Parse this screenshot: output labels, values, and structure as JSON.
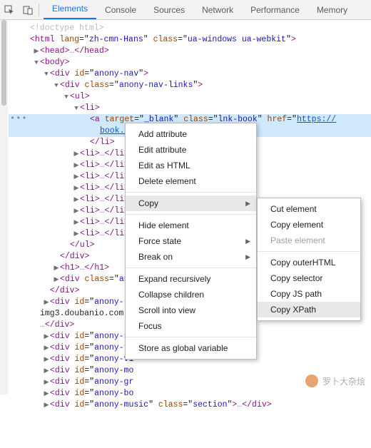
{
  "tabs": [
    "Elements",
    "Console",
    "Sources",
    "Network",
    "Performance",
    "Memory"
  ],
  "active_tab": 0,
  "dom_lines": [
    {
      "i": 1,
      "a": "none",
      "html": "<span class='doctype'>&lt;!doctype html&gt;</span>"
    },
    {
      "i": 1,
      "a": "none",
      "html": "<span class='tagb'>&lt;html</span> <span class='attrn'>lang</span>=\"<span class='attrv'>zh-cmn-Hans</span>\" <span class='attrn'>class</span>=\"<span class='attrv'>ua-windows ua-webkit</span>\"<span class='tagb'>&gt;</span>"
    },
    {
      "i": 2,
      "a": "right",
      "html": "<span class='tagb'>&lt;head&gt;</span><span class='ellips'>…</span><span class='tagb'>&lt;/head&gt;</span>"
    },
    {
      "i": 2,
      "a": "down",
      "html": "<span class='tagb'>&lt;body&gt;</span>"
    },
    {
      "i": 3,
      "a": "down",
      "html": "<span class='tagb'>&lt;div</span> <span class='attrn'>id</span>=\"<span class='attrv'>anony-nav</span>\"<span class='tagb'>&gt;</span>"
    },
    {
      "i": 4,
      "a": "down",
      "html": "<span class='tagb'>&lt;div</span> <span class='attrn'>class</span>=\"<span class='attrv'>anony-nav-links</span>\"<span class='tagb'>&gt;</span>"
    },
    {
      "i": 5,
      "a": "down",
      "html": "<span class='tagb'>&lt;ul&gt;</span>"
    },
    {
      "i": 6,
      "a": "down",
      "html": "<span class='tagb'>&lt;li&gt;</span>"
    },
    {
      "i": 7,
      "a": "none",
      "sel": true,
      "html": "<span class='tagb'>&lt;a</span> <span class='attrn'>target</span>=\"<span class='attrv'>_blank</span>\" <span class='attrn'>class</span>=\"<span class='attrv'>lnk-book</span>\" <span class='attrn'>href</span>=\"<span class='url'>https://</span>"
    },
    {
      "i": 8,
      "a": "none",
      "sel": true,
      "html": "<span class='url'>book.doub</span>"
    },
    {
      "i": 7,
      "a": "none",
      "html": "<span class='tagb'>&lt;/li&gt;</span>"
    },
    {
      "i": 6,
      "a": "right",
      "html": "<span class='tagb'>&lt;li&gt;</span><span class='ellips'>…</span><span class='tagb'>&lt;/li&gt;</span>"
    },
    {
      "i": 6,
      "a": "right",
      "html": "<span class='tagb'>&lt;li&gt;</span><span class='ellips'>…</span><span class='tagb'>&lt;/li&gt;</span>"
    },
    {
      "i": 6,
      "a": "right",
      "html": "<span class='tagb'>&lt;li&gt;</span><span class='ellips'>…</span><span class='tagb'>&lt;/li&gt;</span>"
    },
    {
      "i": 6,
      "a": "right",
      "html": "<span class='tagb'>&lt;li&gt;</span><span class='ellips'>…</span><span class='tagb'>&lt;/li&gt;</span>"
    },
    {
      "i": 6,
      "a": "right",
      "html": "<span class='tagb'>&lt;li&gt;</span><span class='ellips'>…</span><span class='tagb'>&lt;/li&gt;</span>"
    },
    {
      "i": 6,
      "a": "right",
      "html": "<span class='tagb'>&lt;li&gt;</span><span class='ellips'>…</span><span class='tagb'>&lt;/li&gt;</span>"
    },
    {
      "i": 6,
      "a": "right",
      "html": "<span class='tagb'>&lt;li&gt;</span><span class='ellips'>…</span><span class='tagb'>&lt;/li&gt;</span>"
    },
    {
      "i": 6,
      "a": "right",
      "html": "<span class='tagb'>&lt;li&gt;</span><span class='ellips'>…</span><span class='tagb'>&lt;/li&gt;</span>"
    },
    {
      "i": 5,
      "a": "none",
      "html": "<span class='tagb'>&lt;/ul&gt;</span>"
    },
    {
      "i": 4,
      "a": "none",
      "html": "<span class='tagb'>&lt;/div&gt;</span>"
    },
    {
      "i": 4,
      "a": "right",
      "html": "<span class='tagb'>&lt;h1&gt;</span><span class='ellips'>…</span><span class='tagb'>&lt;/h1&gt;</span>"
    },
    {
      "i": 4,
      "a": "right",
      "html": "<span class='tagb'>&lt;div</span> <span class='attrn'>class</span>=\"<span class='attrv'>anon</span>"
    },
    {
      "i": 3,
      "a": "none",
      "html": "<span class='tagb'>&lt;/div&gt;</span>"
    },
    {
      "i": 3,
      "a": "right",
      "html": "<span class='tagb'>&lt;div</span> <span class='attrn'>id</span>=\"<span class='attrv'>anony-re</span>"
    },
    {
      "i": 2,
      "a": "none",
      "html": "img3.doubanio.com"
    },
    {
      "i": 2,
      "a": "none",
      "html": "<span class='ellips'>…</span><span class='tagb'>&lt;/div&gt;</span>"
    },
    {
      "i": 3,
      "a": "right",
      "html": "<span class='tagb'>&lt;div</span> <span class='attrn'>id</span>=\"<span class='attrv'>anony-sn</span>"
    },
    {
      "i": 3,
      "a": "right",
      "html": "<span class='tagb'>&lt;div</span> <span class='attrn'>id</span>=\"<span class='attrv'>anony-ti</span>"
    },
    {
      "i": 3,
      "a": "right",
      "html": "<span class='tagb'>&lt;div</span> <span class='attrn'>id</span>=\"<span class='attrv'>anony-vi</span>"
    },
    {
      "i": 3,
      "a": "right",
      "html": "<span class='tagb'>&lt;div</span> <span class='attrn'>id</span>=\"<span class='attrv'>anony-mo</span>"
    },
    {
      "i": 3,
      "a": "right",
      "html": "<span class='tagb'>&lt;div</span> <span class='attrn'>id</span>=\"<span class='attrv'>anony-gr</span>"
    },
    {
      "i": 3,
      "a": "right",
      "html": "<span class='tagb'>&lt;div</span> <span class='attrn'>id</span>=\"<span class='attrv'>anony-bo</span>"
    },
    {
      "i": 3,
      "a": "right",
      "html": "<span class='tagb'>&lt;div</span> <span class='attrn'>id</span>=\"<span class='attrv'>anony-music</span>\" <span class='attrn'>class</span>=\"<span class='attrv'>section</span>\"<span class='tagb'>&gt;</span><span class='ellips'>…</span><span class='tagb'>&lt;/div&gt;</span>"
    }
  ],
  "menu1": {
    "groups": [
      [
        {
          "l": "Add attribute"
        },
        {
          "l": "Edit attribute"
        },
        {
          "l": "Edit as HTML"
        },
        {
          "l": "Delete element"
        }
      ],
      [
        {
          "l": "Copy",
          "sub": true,
          "hover": true
        }
      ],
      [
        {
          "l": "Hide element"
        },
        {
          "l": "Force state",
          "sub": true
        },
        {
          "l": "Break on",
          "sub": true
        }
      ],
      [
        {
          "l": "Expand recursively"
        },
        {
          "l": "Collapse children"
        },
        {
          "l": "Scroll into view"
        },
        {
          "l": "Focus"
        }
      ],
      [
        {
          "l": "Store as global variable"
        }
      ]
    ]
  },
  "menu2": {
    "groups": [
      [
        {
          "l": "Cut element"
        },
        {
          "l": "Copy element"
        },
        {
          "l": "Paste element",
          "disabled": true
        }
      ],
      [
        {
          "l": "Copy outerHTML"
        },
        {
          "l": "Copy selector"
        },
        {
          "l": "Copy JS path"
        },
        {
          "l": "Copy XPath",
          "hover": true
        }
      ]
    ]
  },
  "watermark": "罗卜大杂烩"
}
